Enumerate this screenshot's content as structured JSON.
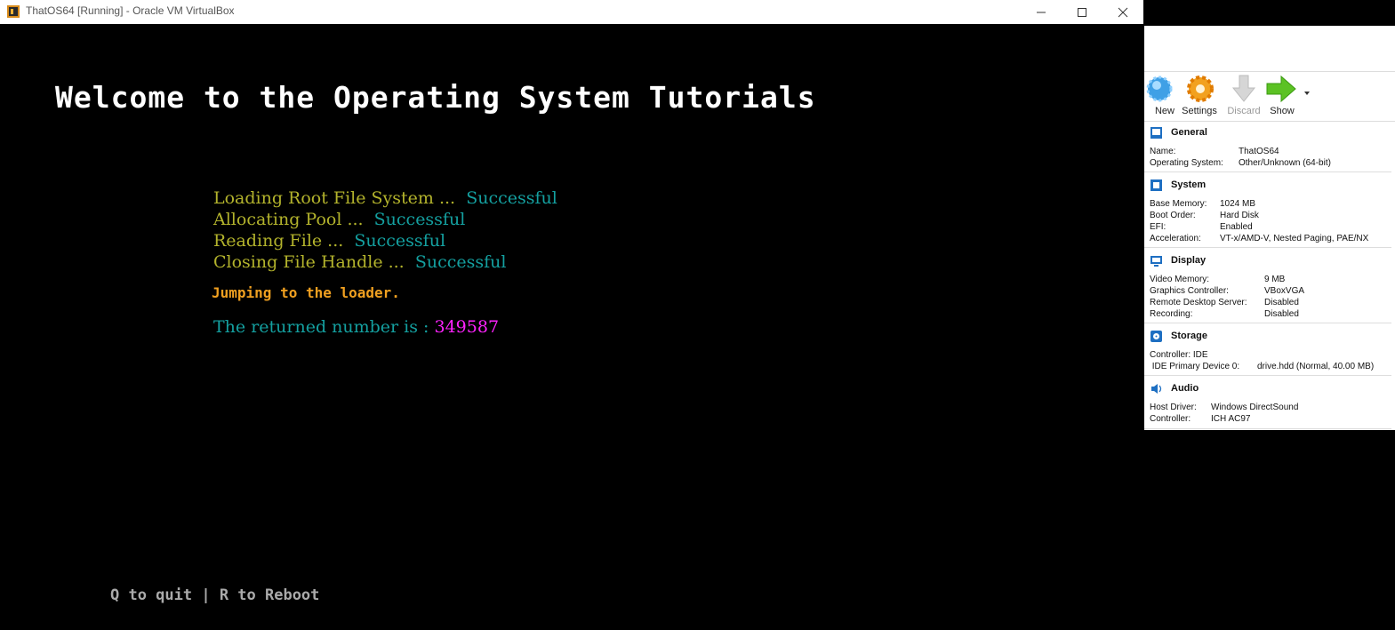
{
  "window": {
    "title": "ThatOS64 [Running] - Oracle VM VirtualBox"
  },
  "screen": {
    "welcome": "Welcome to the Operating System Tutorials",
    "log": [
      {
        "text": "Loading Root File System ...",
        "status": "Successful"
      },
      {
        "text": "Allocating Pool ...",
        "status": "Successful"
      },
      {
        "text": "Reading File ...",
        "status": "Successful"
      },
      {
        "text": "Closing File Handle ...",
        "status": "Successful"
      }
    ],
    "jumping": "Jumping to the loader.",
    "returned_label": "The returned number is :",
    "returned_value": "349587",
    "footer": "Q to quit | R to Reboot"
  },
  "toolbar": {
    "new": "New",
    "settings": "Settings",
    "discard": "Discard",
    "show": "Show"
  },
  "details": {
    "general": {
      "title": "General",
      "rows": [
        {
          "k": "Name:",
          "v": "ThatOS64"
        },
        {
          "k": "Operating System:",
          "v": "Other/Unknown (64-bit)"
        }
      ]
    },
    "system": {
      "title": "System",
      "rows": [
        {
          "k": "Base Memory:",
          "v": "1024 MB"
        },
        {
          "k": "Boot Order:",
          "v": "Hard Disk"
        },
        {
          "k": "EFI:",
          "v": "Enabled"
        },
        {
          "k": "Acceleration:",
          "v": "VT-x/AMD-V, Nested Paging, PAE/NX"
        }
      ]
    },
    "display": {
      "title": "Display",
      "rows": [
        {
          "k": "Video Memory:",
          "v": "9 MB"
        },
        {
          "k": "Graphics Controller:",
          "v": "VBoxVGA"
        },
        {
          "k": "Remote Desktop Server:",
          "v": "Disabled"
        },
        {
          "k": "Recording:",
          "v": "Disabled"
        }
      ]
    },
    "storage": {
      "title": "Storage",
      "rows": [
        {
          "k": "Controller: IDE",
          "v": ""
        },
        {
          "k": " IDE Primary Device 0:",
          "v": "drive.hdd (Normal, 40.00 MB)"
        }
      ]
    },
    "audio": {
      "title": "Audio",
      "rows": [
        {
          "k": "Host Driver:",
          "v": "Windows DirectSound"
        },
        {
          "k": "Controller:",
          "v": "ICH AC97"
        }
      ]
    }
  }
}
